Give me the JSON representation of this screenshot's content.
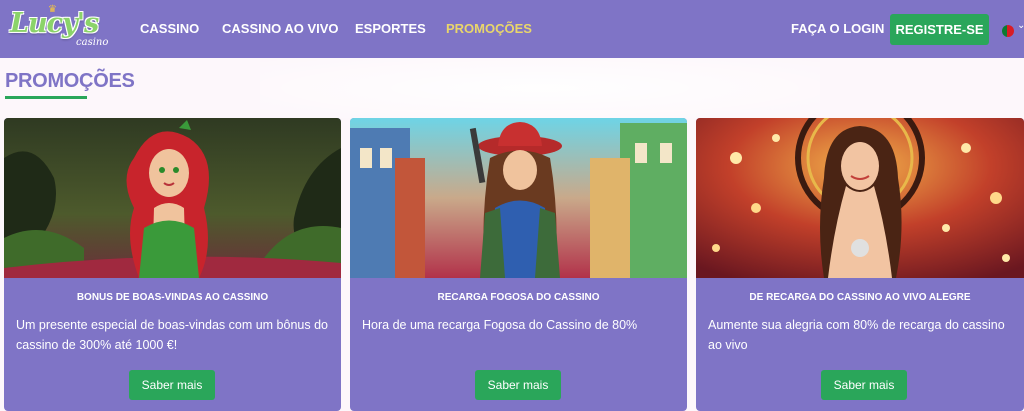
{
  "header": {
    "logo_text": "Lucy's",
    "logo_sub": "casino",
    "nav": [
      {
        "label": "CASSINO"
      },
      {
        "label": "CASSINO AO VIVO"
      },
      {
        "label": "ESPORTES"
      },
      {
        "label": "PROMOÇÕES",
        "active": true
      }
    ],
    "login_label": "FAÇA O LOGIN",
    "register_label": "REGISTRE-SE",
    "language_flag": "portugal-flag-icon",
    "colors": {
      "header_bg": "#7f74c6",
      "accent": "#2aa65a",
      "active_nav": "#e9d66b"
    }
  },
  "main": {
    "title": "PROMOÇÕES",
    "cards": [
      {
        "title": "BONUS DE BOAS-VINDAS AO CASSINO",
        "description": "Um presente especial de boas-vindas com um bônus do cassino de 300% até 1000 €!",
        "button": "Saber mais",
        "image": "jungle-siren-illustration"
      },
      {
        "title": "RECARGA FOGOSA DO CASSINO",
        "description": "Hora de uma recarga Fogosa do Cassino de 80%",
        "button": "Saber mais",
        "image": "cowgirl-western-town-illustration"
      },
      {
        "title": "DE RECARGA DO CASSINO AO VIVO ALEGRE",
        "description": "Aumente sua alegria com 80% de recarga do cassino ao vivo",
        "button": "Saber mais",
        "image": "live-dealer-roulette-photo"
      }
    ]
  }
}
